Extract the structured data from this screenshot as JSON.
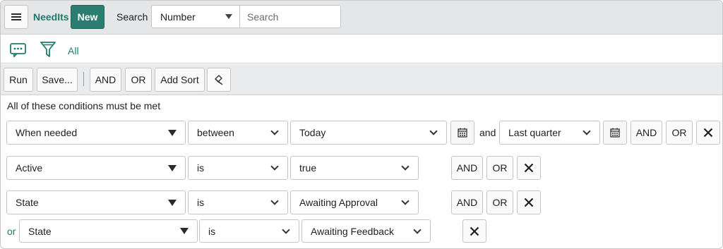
{
  "header": {
    "menu_icon": "hamburger-menu-icon",
    "app_label": "NeedIts",
    "new_label": "New",
    "search_label": "Search",
    "search_field_value": "Number",
    "search_placeholder": "Search"
  },
  "iconbar": {
    "filter_link": "All"
  },
  "toolbar": {
    "run_label": "Run",
    "save_label": "Save...",
    "and_label": "AND",
    "or_label": "OR",
    "add_sort_label": "Add Sort"
  },
  "conditions": {
    "heading": "All of these conditions must be met",
    "rows": [
      {
        "field": "When needed",
        "operator": "between",
        "value": "Today",
        "joiner": "and",
        "value2": "Last quarter",
        "and_label": "AND",
        "or_label": "OR"
      },
      {
        "field": "Active",
        "operator": "is",
        "value": "true",
        "and_label": "AND",
        "or_label": "OR"
      },
      {
        "field": "State",
        "operator": "is",
        "value": "Awaiting Approval",
        "and_label": "AND",
        "or_label": "OR"
      },
      {
        "prefix": "or",
        "field": "State",
        "operator": "is",
        "value": "Awaiting Feedback"
      }
    ]
  },
  "colors": {
    "accent": "#2a7d6f",
    "header_bg": "#e4e6e7",
    "toolbar_bg": "#e9ebec"
  }
}
